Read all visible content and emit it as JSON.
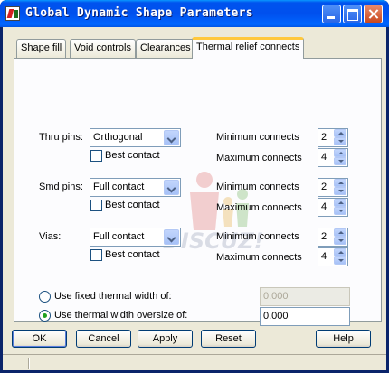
{
  "window": {
    "title": "Global Dynamic Shape Parameters"
  },
  "tabs": [
    {
      "label": "Shape fill"
    },
    {
      "label": "Void controls"
    },
    {
      "label": "Clearances"
    },
    {
      "label": "Thermal relief connects"
    }
  ],
  "thru_pins": {
    "label": "Thru pins:",
    "select": "Orthogonal",
    "best_contact": "Best contact",
    "min_label": "Minimum connects",
    "min_value": "2",
    "max_label": "Maximum connects",
    "max_value": "4"
  },
  "smd_pins": {
    "label": "Smd pins:",
    "select": "Full contact",
    "best_contact": "Best contact",
    "min_label": "Minimum connects",
    "min_value": "2",
    "max_label": "Maximum connects",
    "max_value": "4"
  },
  "vias": {
    "label": "Vias:",
    "select": "Full contact",
    "best_contact": "Best contact",
    "min_label": "Minimum connects",
    "min_value": "2",
    "max_label": "Maximum connects",
    "max_value": "4"
  },
  "thermal_width": {
    "fixed_label": "Use fixed thermal width of:",
    "fixed_value": "0.000",
    "oversize_label": "Use thermal width oversize of:",
    "oversize_value": "0.000"
  },
  "buttons": {
    "ok": "OK",
    "cancel": "Cancel",
    "apply": "Apply",
    "reset": "Reset",
    "help": "Help"
  },
  "watermark": {
    "text": "DISCUZ!"
  },
  "colors": {
    "titlebar": "#0054e3",
    "dialog_bg": "#ece9d8",
    "active_tab_accent": "#ffc83c"
  }
}
